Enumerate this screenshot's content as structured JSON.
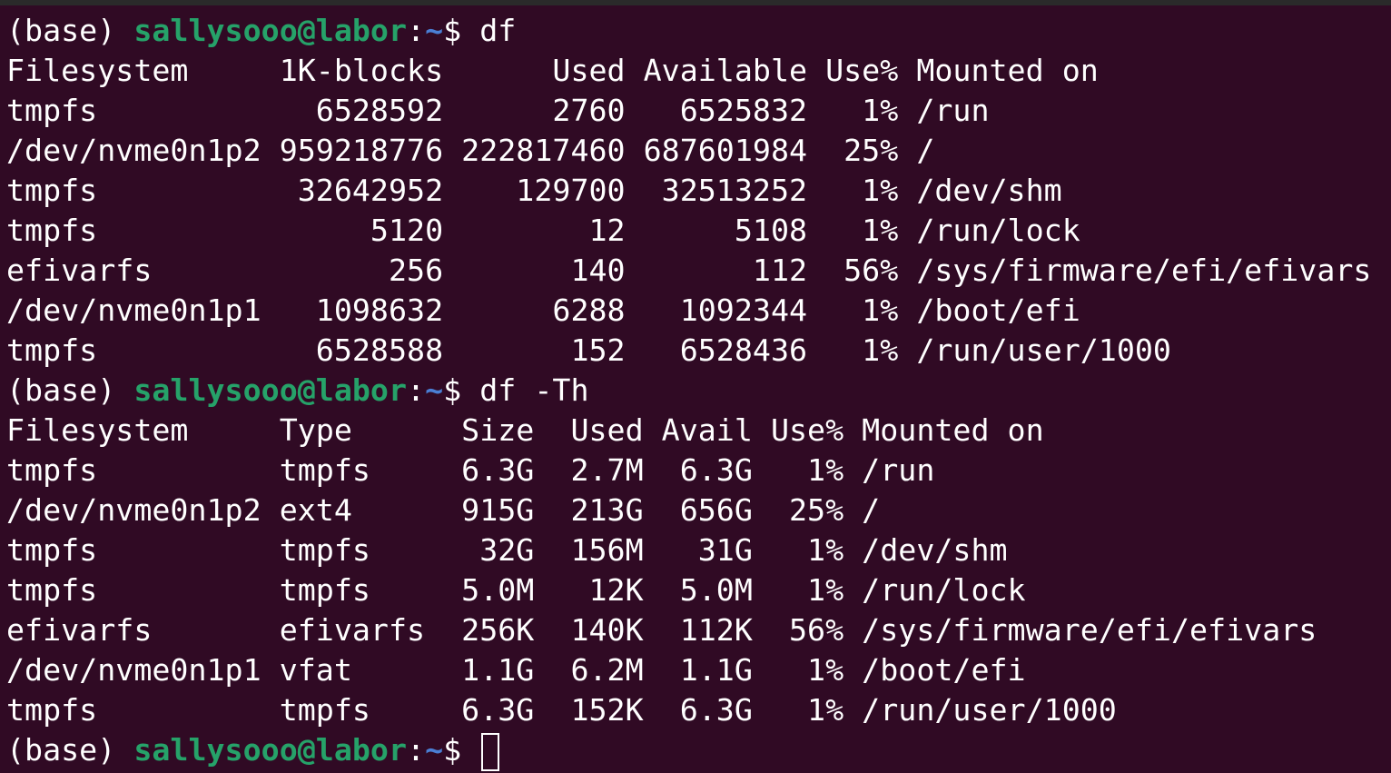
{
  "colors": {
    "background": "#300a24",
    "prompt_user": "#26a269",
    "prompt_path": "#4a7fd4",
    "text": "#ffffff"
  },
  "prompt": {
    "env": "(base) ",
    "user_host": "sallysooo@labor",
    "colon": ":",
    "path": "~",
    "symbol": "$ "
  },
  "commands": [
    "df",
    "df -Th"
  ],
  "df": {
    "header": "Filesystem     1K-blocks      Used Available Use% Mounted on",
    "rows": [
      "tmpfs            6528592      2760   6525832   1% /run",
      "/dev/nvme0n1p2 959218776 222817460 687601984  25% /",
      "tmpfs           32642952    129700  32513252   1% /dev/shm",
      "tmpfs               5120        12      5108   1% /run/lock",
      "efivarfs             256       140       112  56% /sys/firmware/efi/efivars",
      "/dev/nvme0n1p1   1098632      6288   1092344   1% /boot/efi",
      "tmpfs            6528588       152   6528436   1% /run/user/1000"
    ]
  },
  "df_th": {
    "header": "Filesystem     Type      Size  Used Avail Use% Mounted on",
    "rows": [
      "tmpfs          tmpfs     6.3G  2.7M  6.3G   1% /run",
      "/dev/nvme0n1p2 ext4      915G  213G  656G  25% /",
      "tmpfs          tmpfs      32G  156M   31G   1% /dev/shm",
      "tmpfs          tmpfs     5.0M   12K  5.0M   1% /run/lock",
      "efivarfs       efivarfs  256K  140K  112K  56% /sys/firmware/efi/efivars",
      "/dev/nvme0n1p1 vfat      1.1G  6.2M  1.1G   1% /boot/efi",
      "tmpfs          tmpfs     6.3G  152K  6.3G   1% /run/user/1000"
    ]
  }
}
